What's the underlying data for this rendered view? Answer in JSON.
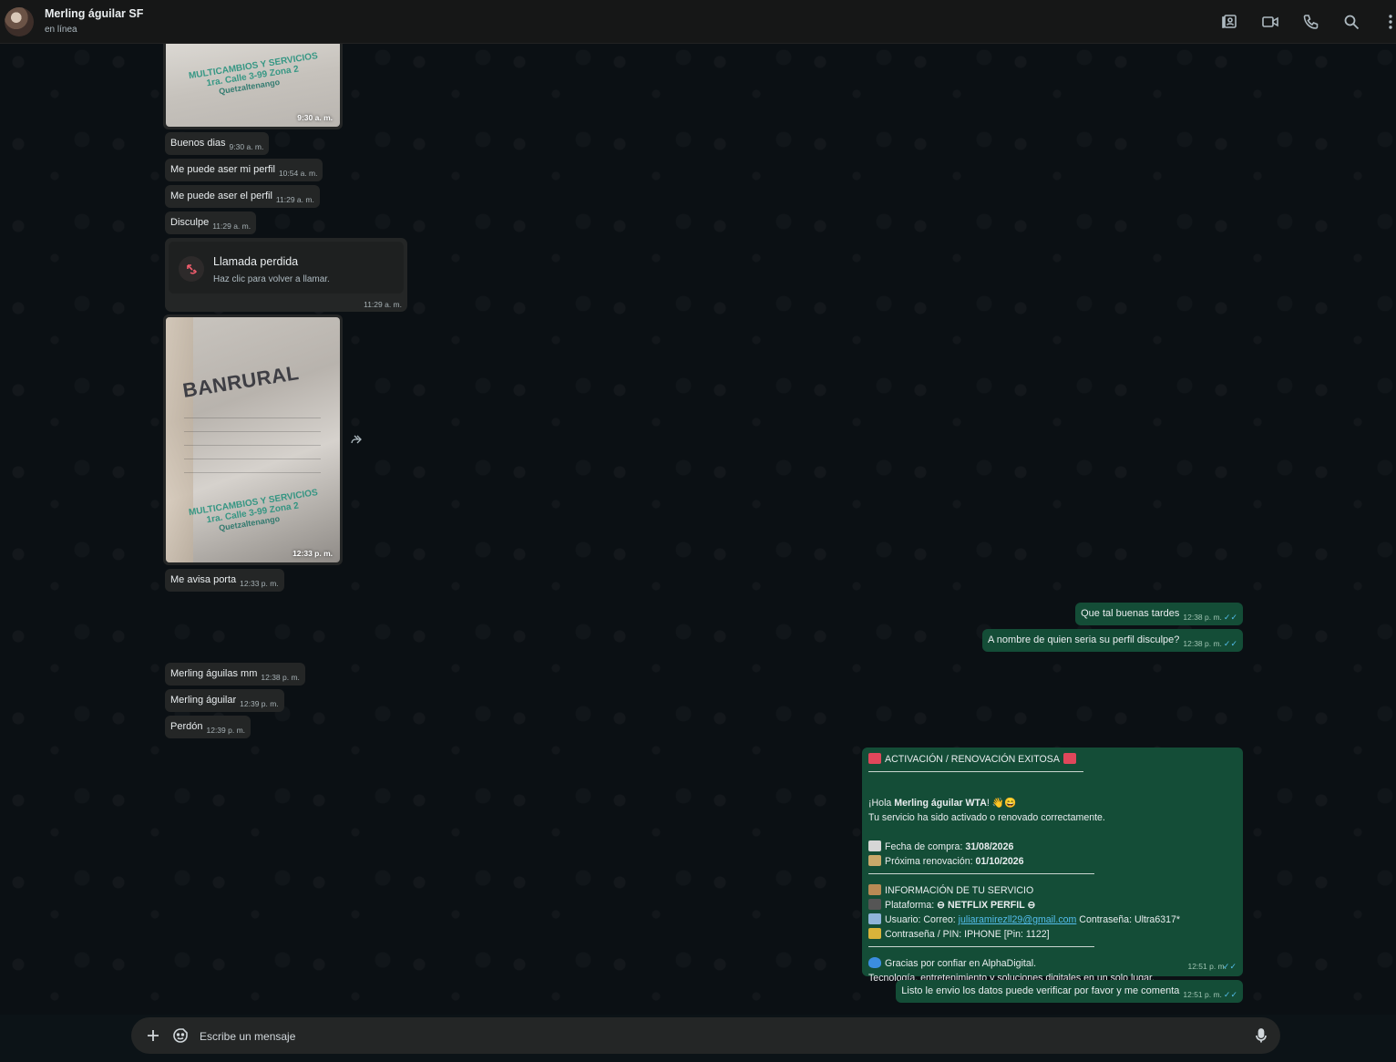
{
  "header": {
    "contact_name": "Merling águilar SF",
    "status": "en línea",
    "icons": [
      "contacts-icon",
      "video-call-icon",
      "voice-call-icon",
      "search-icon",
      "menu-icon"
    ]
  },
  "messages": {
    "image1": {
      "time": "9:30 a. m.",
      "stamp_line1": "MULTICAMBIOS Y SERVICIOS",
      "stamp_line2": "1ra. Calle 3-99 Zona 2",
      "stamp_line3": "Quetzaltenango"
    },
    "m1": {
      "text": "Buenos dias",
      "time": "9:30 a. m."
    },
    "m2": {
      "text": "Me puede aser mi perfil",
      "time": "10:54 a. m."
    },
    "m3": {
      "text": "Me puede aser el perfil",
      "time": "11:29 a. m."
    },
    "m4": {
      "text": "Disculpe",
      "time": "11:29 a. m."
    },
    "missed_call": {
      "title": "Llamada perdida",
      "subtitle": "Haz clic para volver a llamar.",
      "time": "11:29 a. m."
    },
    "image2": {
      "time": "12:33 p. m.",
      "brand": "BANRURAL",
      "stamp_line1": "MULTICAMBIOS Y SERVICIOS",
      "stamp_line2": "1ra. Calle 3-99 Zona 2",
      "stamp_line3": "Quetzaltenango"
    },
    "m5": {
      "text": "Me avisa porta",
      "time": "12:33 p. m."
    },
    "o1": {
      "text": "Que tal buenas tardes",
      "time": "12:38 p. m."
    },
    "o2": {
      "text": "A nombre de quien seria su perfil disculpe?",
      "time": "12:38 p. m."
    },
    "m6": {
      "text": "Merling águilas mm",
      "time": "12:38 p. m."
    },
    "m7": {
      "text": "Merling águilar",
      "time": "12:39 p. m."
    },
    "m8": {
      "text": "Perdón",
      "time": "12:39 p. m."
    },
    "activation": {
      "title": "ACTIVACIÓN / RENOVACIÓN EXITOSA",
      "greeting_prefix": "¡Hola ",
      "greeting_name": "Merling águilar WTA",
      "greeting_suffix": "! 👋😄",
      "line_activated": "Tu servicio ha sido activado o renovado correctamente.",
      "purchase_label": "Fecha de compra: ",
      "purchase_date": "31/08/2026",
      "renewal_label": "Próxima renovación: ",
      "renewal_date": "01/10/2026",
      "info_title": "INFORMACIÓN DE TU SERVICIO",
      "platform_label": "Plataforma: ",
      "platform_value": "⊖ NETFLIX PERFIL ⊖",
      "user_label": "Usuario: Correo: ",
      "user_email": "juliaramirezll29@gmail.com",
      "user_password": " Contraseña: Ultra6317*",
      "pin_line": "Contraseña / PIN: IPHONE [Pin: 1122]",
      "thanks": "Gracias por confiar en AlphaDigital.",
      "tagline": "Tecnología, entretenimiento y soluciones digitales en un solo lugar.",
      "time": "12:51 p. m."
    },
    "o3": {
      "text": "Listo le envio los datos puede verificar por favor y me comenta",
      "time": "12:51 p. m."
    }
  },
  "composer": {
    "placeholder": "Escribe un mensaje"
  },
  "colors": {
    "incoming": "#242626",
    "outgoing": "#144d37",
    "read_ticks": "#53bdeb",
    "missed_call": "#f15c6d"
  }
}
